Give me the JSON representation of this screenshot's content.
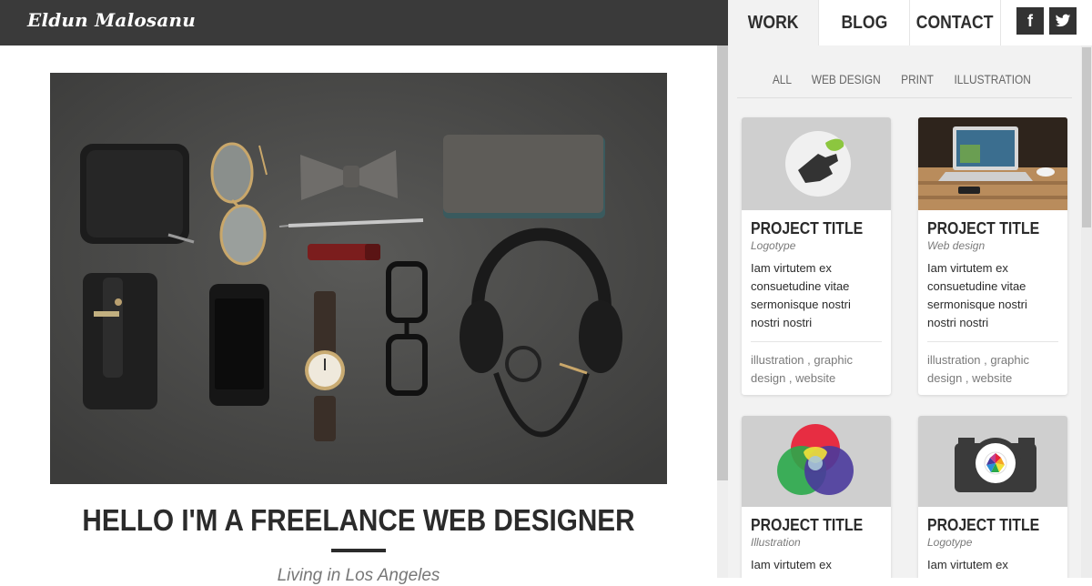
{
  "header": {
    "logo": "Eldun Malosanu"
  },
  "hero": {
    "title": "HELLO I'M A FREELANCE WEB DESIGNER",
    "subtitle": "Living in Los Angeles"
  },
  "nav": {
    "items": [
      {
        "label": "WORK"
      },
      {
        "label": "BLOG"
      },
      {
        "label": "CONTACT"
      }
    ],
    "social": [
      {
        "label": "f",
        "icon": "facebook-icon"
      },
      {
        "label": "",
        "icon": "twitter-icon"
      }
    ]
  },
  "filters": [
    "ALL",
    "WEB DESIGN",
    "PRINT",
    "ILLUSTRATION"
  ],
  "projects": [
    {
      "title": "PROJECT TITLE",
      "category": "Logotype",
      "description": "Iam virtutem ex consuetudine vitae sermonisque nostri nostri nostri",
      "tags": [
        "illustration",
        "graphic design",
        "website"
      ],
      "thumb_icon": "hand-leaf-logo-icon"
    },
    {
      "title": "PROJECT TITLE",
      "category": "Web design",
      "description": "Iam virtutem ex consuetudine vitae sermonisque nostri nostri nostri",
      "tags": [
        "illustration",
        "graphic design",
        "website"
      ],
      "thumb_icon": "laptop-photo"
    },
    {
      "title": "PROJECT TITLE",
      "category": "Illustration",
      "description": "Iam virtutem ex",
      "tags": [],
      "thumb_icon": "color-circles-icon"
    },
    {
      "title": "PROJECT TITLE",
      "category": "Logotype",
      "description": "Iam virtutem ex",
      "tags": [],
      "thumb_icon": "camera-icon"
    }
  ],
  "colors": {
    "topbar": "#3a3a3a",
    "panel_bg": "#f2f2f2",
    "text_dark": "#2b2b2b",
    "text_muted": "#7a7a7a"
  }
}
